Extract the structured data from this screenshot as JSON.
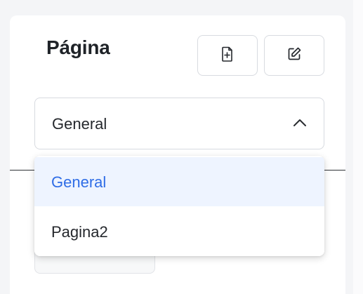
{
  "header": {
    "title": "Página",
    "buttons": [
      {
        "icon": "document-add-icon"
      },
      {
        "icon": "edit-icon"
      }
    ]
  },
  "select": {
    "selected_value": "General",
    "expanded": true,
    "chevron_icon": "chevron-up-icon",
    "options": [
      {
        "label": "General",
        "selected": true
      },
      {
        "label": "Pagina2",
        "selected": false
      }
    ]
  },
  "colors": {
    "accent": "#2F6DE6",
    "selected_background": "#EEF4FF",
    "border": "#D7DAE0",
    "text": "#25282D"
  }
}
